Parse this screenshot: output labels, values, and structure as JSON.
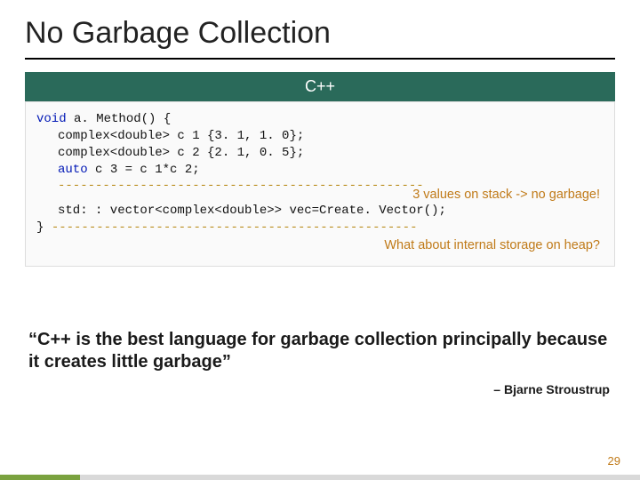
{
  "title": "No Garbage Collection",
  "lang_header": "C++",
  "code": {
    "l1a": "void",
    "l1b": " a. Method() {",
    "l2": "complex<double> c 1 {3. 1, 1. 0};",
    "l3": "complex<double> c 2 {2. 1, 0. 5};",
    "l4a": "auto",
    "l4b": " c 3 = c 1*c 2;",
    "dashes1": "-------------------------------------------------",
    "l5": "std: : vector<complex<double>> vec=Create. Vector();",
    "brace": "} ",
    "dashes2": "-------------------------------------------------"
  },
  "annotations": {
    "a1": "3 values on stack -> no garbage!",
    "a2": "What about internal storage on heap?"
  },
  "quote": "“C++ is the best language for garbage collection principally because it creates little garbage”",
  "attribution": "– Bjarne Stroustrup",
  "page_number": "29"
}
